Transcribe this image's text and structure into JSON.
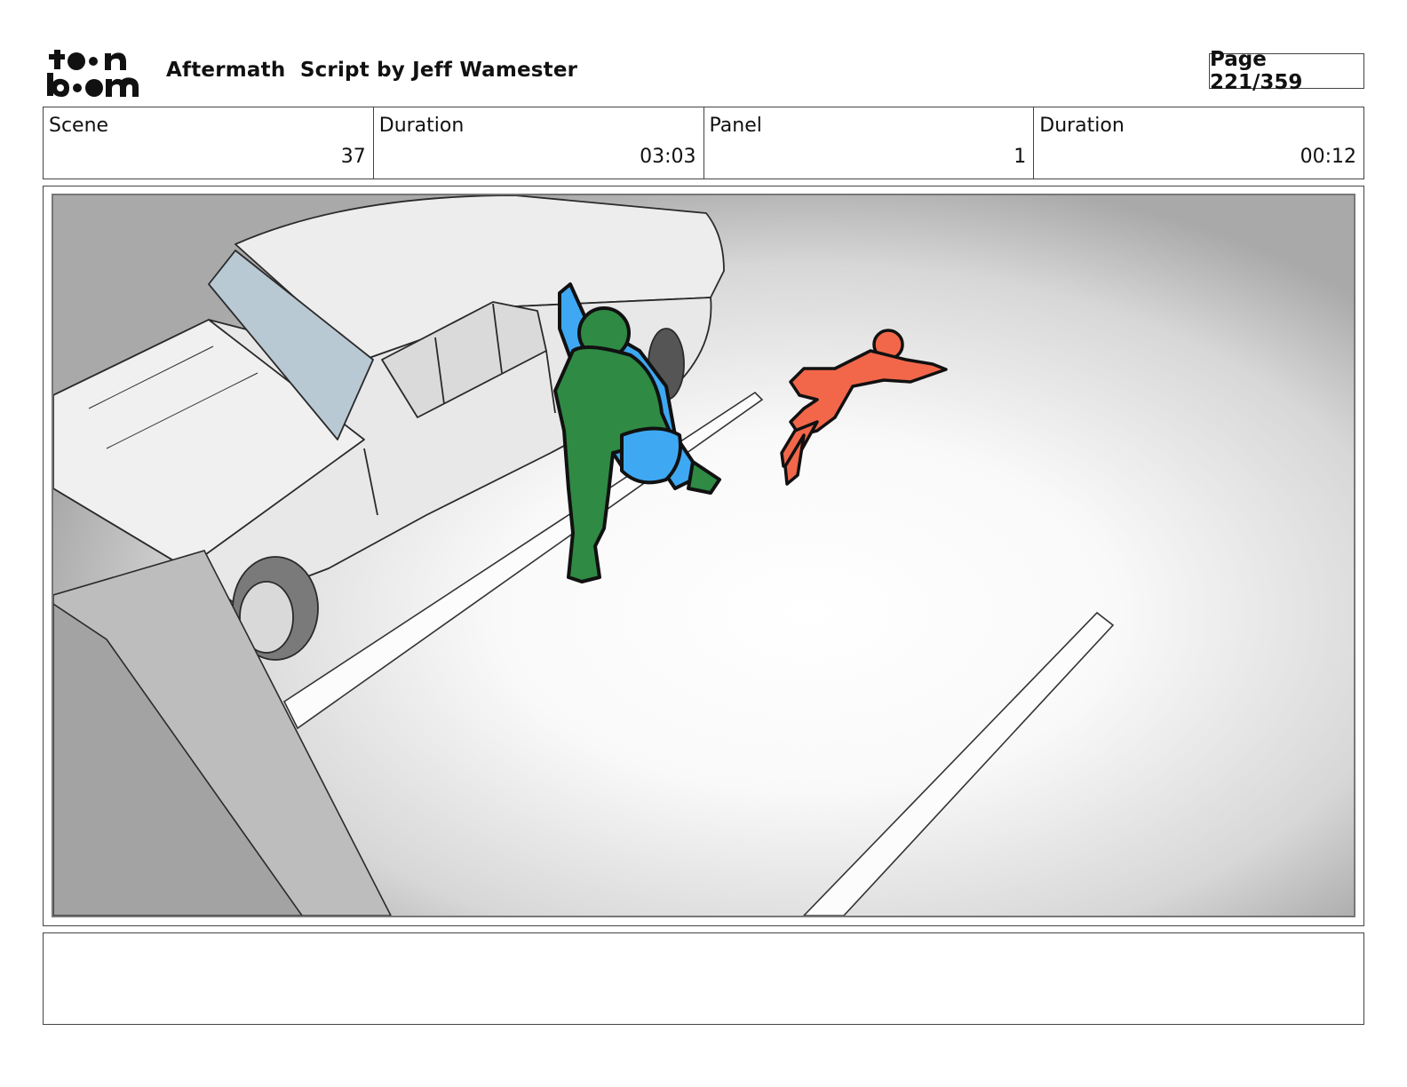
{
  "header": {
    "logo_text": "toon boom",
    "title": "Aftermath  Script by Jeff Wamester",
    "page_label": "Page 221/359"
  },
  "info": [
    {
      "label": "Scene",
      "value": "37"
    },
    {
      "label": "Duration",
      "value": "03:03"
    },
    {
      "label": "Panel",
      "value": "1"
    },
    {
      "label": "Duration",
      "value": "00:12"
    }
  ],
  "panel": {
    "colors": {
      "hero": "#2f8a44",
      "cape": "#3ea9f2",
      "fallen_figure": "#f2674a",
      "car": "#ececec",
      "windshield": "#b9c9d3",
      "pillar": "#9a9a9a"
    }
  },
  "notes": {
    "text": ""
  }
}
